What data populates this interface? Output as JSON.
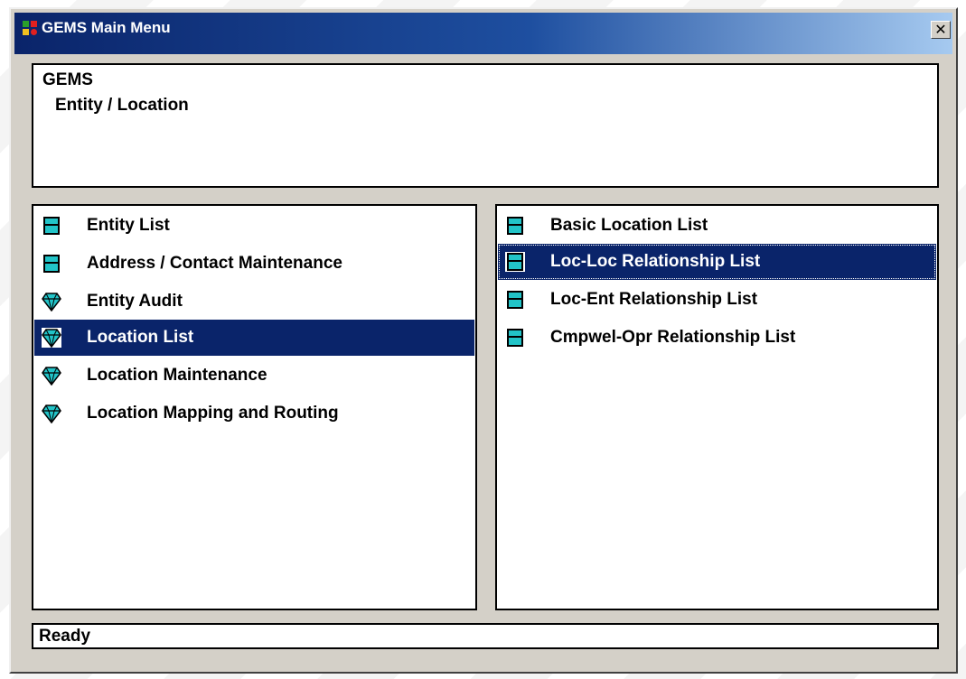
{
  "window": {
    "title": "GEMS Main Menu",
    "close_label": "✕"
  },
  "header": {
    "line1": "GEMS",
    "line2": "Entity / Location"
  },
  "left_list": {
    "items": [
      {
        "label": "Entity List",
        "icon": "list-window-icon",
        "selected": false
      },
      {
        "label": "Address / Contact Maintenance",
        "icon": "list-window-icon",
        "selected": false
      },
      {
        "label": "Entity Audit",
        "icon": "gem-icon",
        "selected": false
      },
      {
        "label": "Location List",
        "icon": "gem-icon",
        "selected": true
      },
      {
        "label": "Location Maintenance",
        "icon": "gem-icon",
        "selected": false
      },
      {
        "label": "Location Mapping and Routing",
        "icon": "gem-icon",
        "selected": false
      }
    ]
  },
  "right_list": {
    "items": [
      {
        "label": "Basic Location List",
        "icon": "list-window-icon",
        "selected": false
      },
      {
        "label": "Loc-Loc Relationship List",
        "icon": "list-window-icon",
        "selected": true
      },
      {
        "label": "Loc-Ent Relationship List",
        "icon": "list-window-icon",
        "selected": false
      },
      {
        "label": "Cmpwel-Opr Relationship List",
        "icon": "list-window-icon",
        "selected": false
      }
    ]
  },
  "status": {
    "text": "Ready"
  },
  "colors": {
    "selection": "#0a246a",
    "icon_teal": "#22c4c8",
    "window_face": "#d4d0c8"
  }
}
